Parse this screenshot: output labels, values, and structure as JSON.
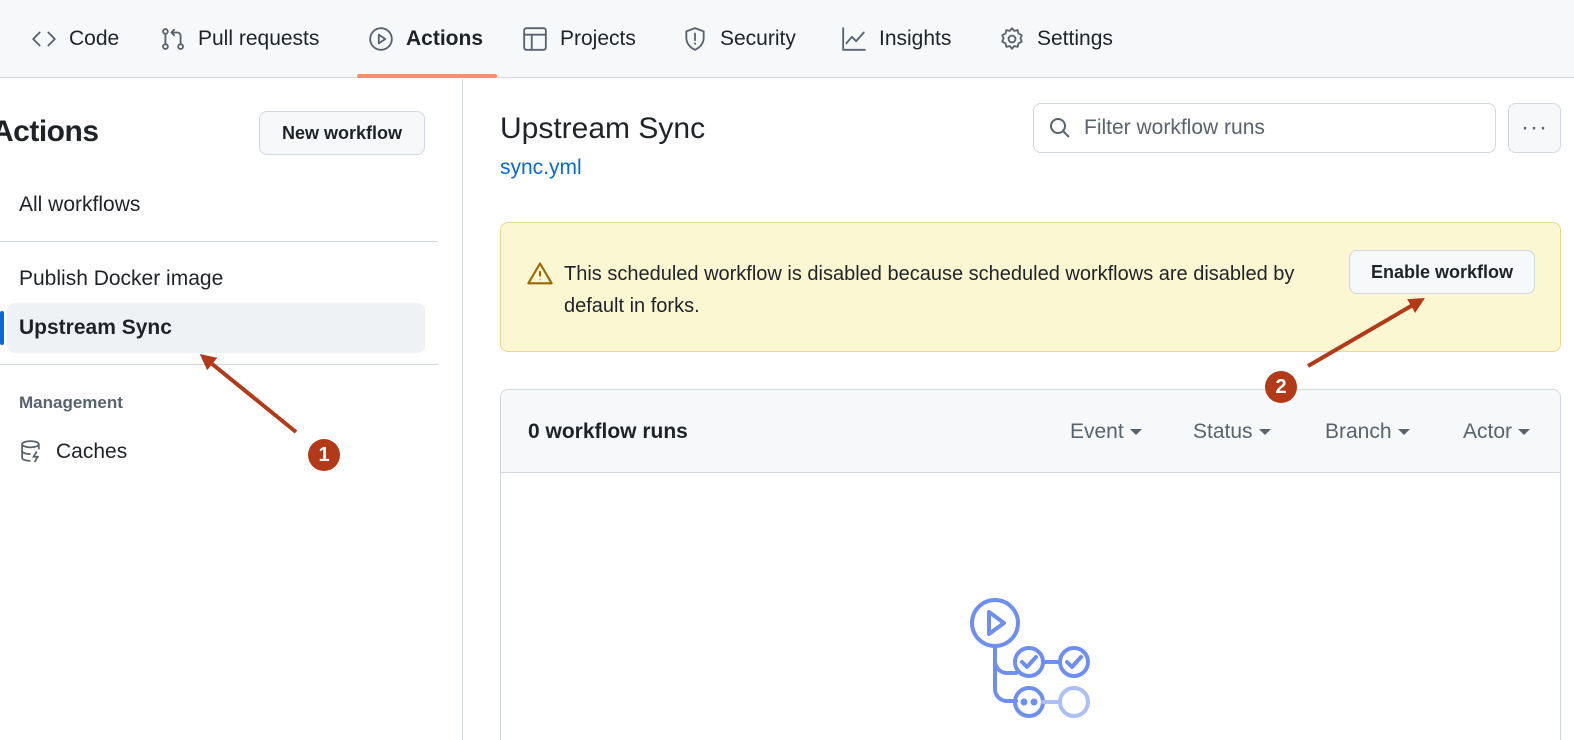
{
  "nav": {
    "tabs": [
      {
        "label": "Code",
        "icon": "code-icon"
      },
      {
        "label": "Pull requests",
        "icon": "pull-request-icon"
      },
      {
        "label": "Actions",
        "icon": "play-icon",
        "active": true
      },
      {
        "label": "Projects",
        "icon": "table-icon"
      },
      {
        "label": "Security",
        "icon": "shield-icon"
      },
      {
        "label": "Insights",
        "icon": "graph-icon"
      },
      {
        "label": "Settings",
        "icon": "gear-icon"
      }
    ],
    "active_underline_color": "#fd8c73"
  },
  "sidebar": {
    "title": "Actions",
    "new_workflow_label": "New workflow",
    "all_workflows_label": "All workflows",
    "workflows": [
      {
        "label": "Publish Docker image"
      },
      {
        "label": "Upstream Sync",
        "selected": true
      }
    ],
    "management_heading": "Management",
    "caches_label": "Caches"
  },
  "main": {
    "title": "Upstream Sync",
    "file_link": "sync.yml",
    "filter_placeholder": "Filter workflow runs",
    "more_label": "···",
    "banner": {
      "text": "This scheduled workflow is disabled because scheduled workflows are disabled by default in forks.",
      "button_label": "Enable workflow",
      "icon": "alert-icon"
    },
    "runs": {
      "count_label": "0 workflow runs",
      "filters": [
        "Event",
        "Status",
        "Branch",
        "Actor"
      ]
    }
  },
  "annotations": {
    "markers": [
      "1",
      "2"
    ],
    "color": "#b33a18"
  },
  "colors": {
    "link": "#0969da",
    "banner_bg": "#fbf7d2",
    "workflow_illustration": "#6e8ef0"
  }
}
